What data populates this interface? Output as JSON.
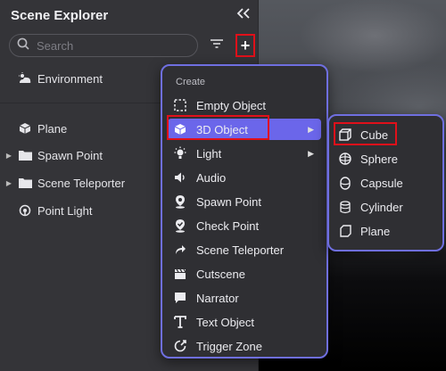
{
  "panel": {
    "title": "Scene Explorer",
    "collapse_icon": "double-chevron-left-icon",
    "search": {
      "placeholder": "Search",
      "value": ""
    },
    "filter_icon": "filter-icon",
    "add_label": "+"
  },
  "tree": {
    "environment": "Environment",
    "items": [
      {
        "label": "Plane",
        "icon": "cube-icon",
        "expandable": false
      },
      {
        "label": "Spawn Point",
        "icon": "folder-icon",
        "expandable": true
      },
      {
        "label": "Scene Teleporter",
        "icon": "folder-icon",
        "expandable": true
      },
      {
        "label": "Point Light",
        "icon": "point-light-icon",
        "expandable": false
      }
    ]
  },
  "menu": {
    "heading": "Create",
    "items": [
      {
        "label": "Empty Object",
        "icon": "empty-object-icon"
      },
      {
        "label": "3D Object",
        "icon": "cube-icon",
        "has_submenu": true,
        "active": true
      },
      {
        "label": "Light",
        "icon": "light-icon",
        "has_submenu": true
      },
      {
        "label": "Audio",
        "icon": "audio-icon"
      },
      {
        "label": "Spawn Point",
        "icon": "spawn-point-icon"
      },
      {
        "label": "Check Point",
        "icon": "check-point-icon"
      },
      {
        "label": "Scene Teleporter",
        "icon": "teleporter-icon"
      },
      {
        "label": "Cutscene",
        "icon": "clapperboard-icon"
      },
      {
        "label": "Narrator",
        "icon": "speech-bubble-icon"
      },
      {
        "label": "Text Object",
        "icon": "text-icon"
      },
      {
        "label": "Trigger Zone",
        "icon": "trigger-zone-icon"
      }
    ]
  },
  "submenu": {
    "items": [
      {
        "label": "Cube",
        "icon": "cube-outline-icon"
      },
      {
        "label": "Sphere",
        "icon": "sphere-icon"
      },
      {
        "label": "Capsule",
        "icon": "capsule-icon"
      },
      {
        "label": "Cylinder",
        "icon": "cylinder-icon"
      },
      {
        "label": "Plane",
        "icon": "plane-icon"
      }
    ]
  },
  "colors": {
    "accent": "#6b66ea",
    "menu_border": "#6f6fe0",
    "highlight": "#e0101a",
    "panel_bg": "#343438"
  }
}
